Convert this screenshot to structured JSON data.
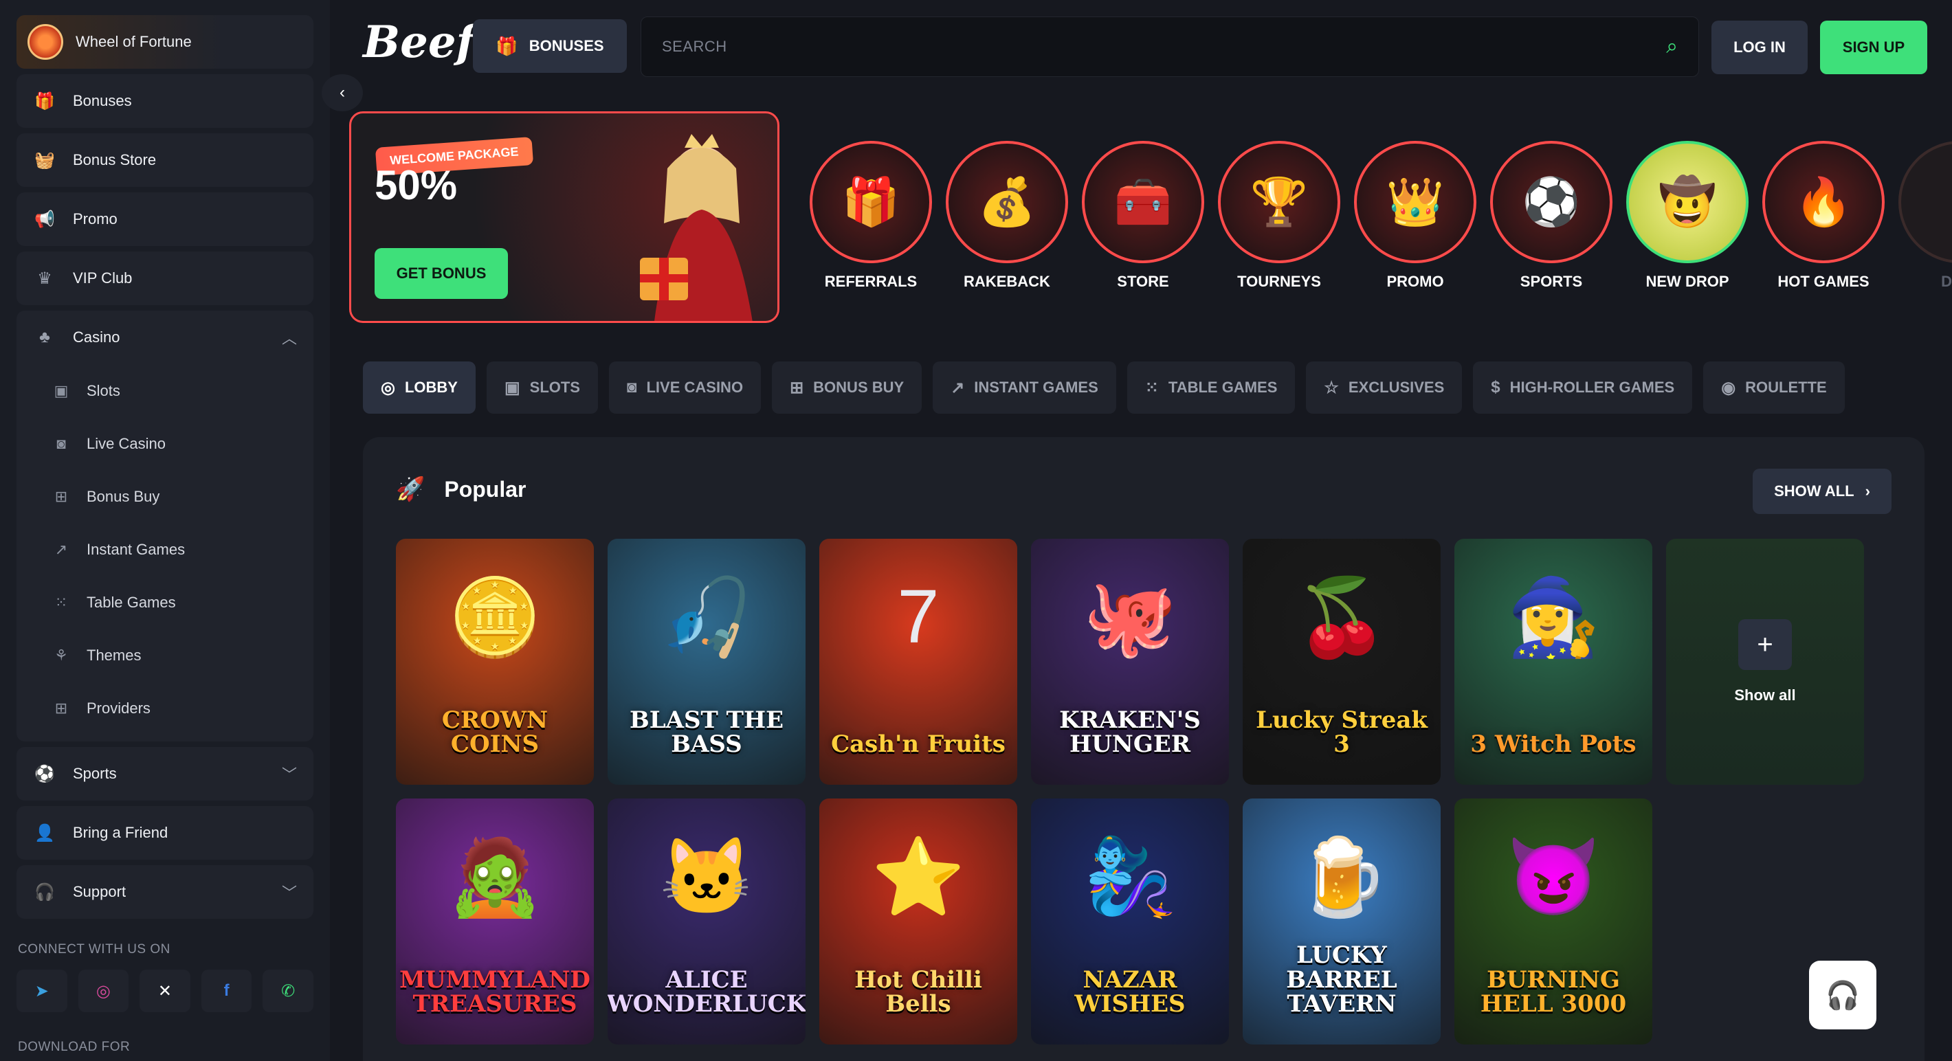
{
  "sidebar": {
    "wheel": "Wheel of Fortune",
    "items": [
      {
        "label": "Bonuses",
        "icon": "gift-icon"
      },
      {
        "label": "Bonus Store",
        "icon": "basket-icon"
      },
      {
        "label": "Promo",
        "icon": "megaphone-icon"
      },
      {
        "label": "VIP Club",
        "icon": "crown-icon"
      }
    ],
    "casino": {
      "label": "Casino",
      "sub": [
        {
          "label": "Slots",
          "icon": "slot-icon"
        },
        {
          "label": "Live Casino",
          "icon": "live-icon"
        },
        {
          "label": "Bonus Buy",
          "icon": "gift-icon"
        },
        {
          "label": "Instant Games",
          "icon": "chart-icon"
        },
        {
          "label": "Table Games",
          "icon": "dice-icon"
        },
        {
          "label": "Themes",
          "icon": "themes-icon"
        },
        {
          "label": "Providers",
          "icon": "grid-icon"
        }
      ]
    },
    "sports": "Sports",
    "bring_friend": "Bring a Friend",
    "support": "Support",
    "connect_label": "CONNECT WITH US ON",
    "download_label": "DOWNLOAD FOR"
  },
  "header": {
    "logo": "Beef",
    "bonuses": "BONUSES",
    "search_placeholder": "SEARCH",
    "login": "LOG IN",
    "signup": "SIGN UP"
  },
  "banner": {
    "tag": "WELCOME PACKAGE",
    "percent": "50%",
    "cta": "GET BONUS"
  },
  "categories": [
    {
      "label": "REFERRALS",
      "emoji": "🎁"
    },
    {
      "label": "RAKEBACK",
      "emoji": "💰"
    },
    {
      "label": "STORE",
      "emoji": "🧰"
    },
    {
      "label": "TOURNEYS",
      "emoji": "🏆"
    },
    {
      "label": "PROMO",
      "emoji": "👑"
    },
    {
      "label": "SPORTS",
      "emoji": "⚽"
    },
    {
      "label": "NEW DROP",
      "emoji": "🤠"
    },
    {
      "label": "HOT GAMES",
      "emoji": "🔥"
    },
    {
      "label": "DOW",
      "emoji": ""
    }
  ],
  "tabs": [
    {
      "label": "LOBBY",
      "icon": "◎"
    },
    {
      "label": "SLOTS",
      "icon": "▣"
    },
    {
      "label": "LIVE CASINO",
      "icon": "◙"
    },
    {
      "label": "BONUS BUY",
      "icon": "⊞"
    },
    {
      "label": "INSTANT GAMES",
      "icon": "↗"
    },
    {
      "label": "TABLE GAMES",
      "icon": "⁙"
    },
    {
      "label": "EXCLUSIVES",
      "icon": "☆"
    },
    {
      "label": "HIGH-ROLLER GAMES",
      "icon": "$"
    },
    {
      "label": "ROULETTE",
      "icon": "◉"
    }
  ],
  "popular": {
    "title": "Popular",
    "show_all": "SHOW ALL",
    "show_all_tile": "Show all",
    "games": [
      {
        "title": "CROWN COINS",
        "bg": "#c8481a",
        "color": "#ffb12c",
        "emoji": "🪙"
      },
      {
        "title": "BLAST THE BASS",
        "bg": "#2f6a8e",
        "color": "#ffffff",
        "emoji": "🎣"
      },
      {
        "title": "Cash'n Fruits",
        "bg": "#d83a1e",
        "color": "#ffcf3d",
        "emoji": "7"
      },
      {
        "title": "KRAKEN'S HUNGER",
        "bg": "#43296b",
        "color": "#ffffff",
        "emoji": "🐙"
      },
      {
        "title": "Lucky Streak 3",
        "bg": "#1b1b1b",
        "color": "#ffcf3d",
        "emoji": "🍒"
      },
      {
        "title": "3 Witch Pots",
        "bg": "#2b6b4e",
        "color": "#ff9b2c",
        "emoji": "🧙‍♀️"
      },
      {
        "title": "MUMMYLAND TREASURES",
        "bg": "#7a2b9c",
        "color": "#ff3e3e",
        "emoji": "🧟"
      },
      {
        "title": "ALICE WONDERLUCK",
        "bg": "#3a2a6e",
        "color": "#e9d4ff",
        "emoji": "🐱"
      },
      {
        "title": "Hot Chilli Bells",
        "bg": "#c8301c",
        "color": "#ffd86b",
        "emoji": "⭐"
      },
      {
        "title": "NAZAR WISHES",
        "bg": "#1e2b6b",
        "color": "#ffcf3d",
        "emoji": "🧞‍♀️"
      },
      {
        "title": "LUCKY BARREL TAVERN",
        "bg": "#3b7ec4",
        "color": "#ffffff",
        "emoji": "🍺"
      },
      {
        "title": "BURNING HELL 3000",
        "bg": "#2e5a1e",
        "color": "#ffb12c",
        "emoji": "😈"
      }
    ]
  },
  "colors": {
    "accent": "#3ee07a",
    "banner_border": "#ff4b4b"
  }
}
